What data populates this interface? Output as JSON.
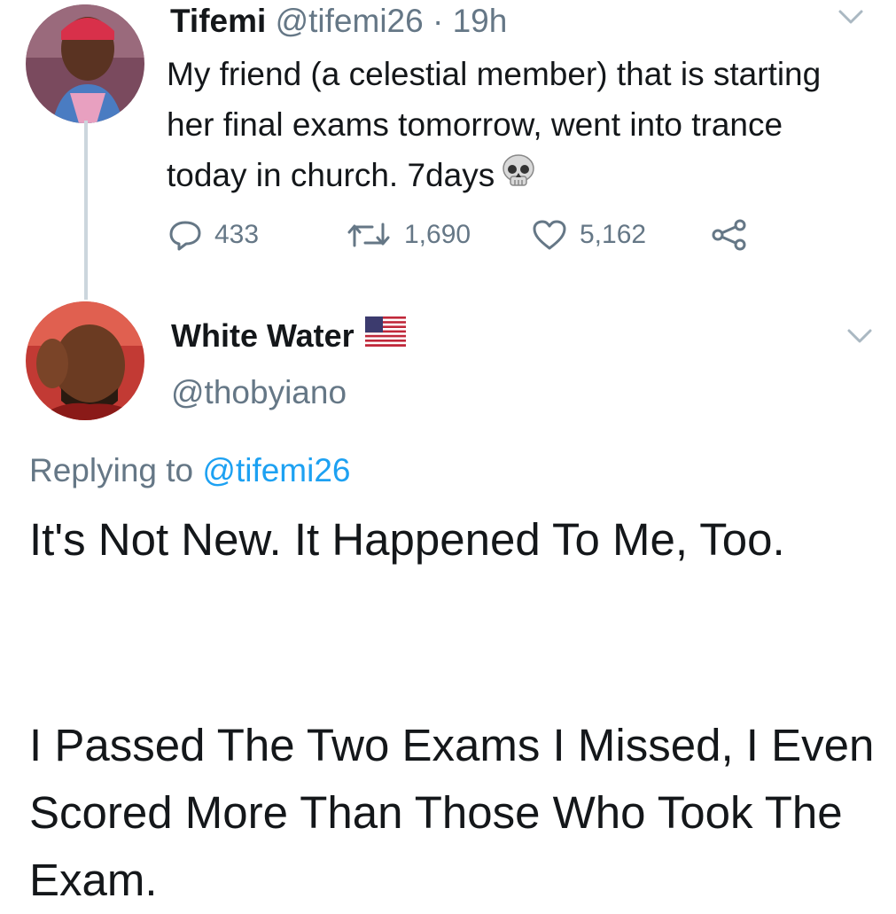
{
  "tweet1": {
    "name": "Tifemi",
    "handle": "@tifemi26",
    "separator": "·",
    "time": "19h",
    "text": "My friend (a celestial member) that is starting her final exams tomorrow, went into trance today in church. 7days",
    "emoji_icon": "skull-icon",
    "actions": {
      "replies": "433",
      "retweets": "1,690",
      "likes": "5,162"
    }
  },
  "tweet2": {
    "name": "White Water",
    "flag_icon": "us-flag-icon",
    "handle": "@thobyiano",
    "replying_prefix": "Replying to",
    "replying_mention": "@tifemi26",
    "paragraph1": "It's Not New. It Happened To Me, Too.",
    "paragraph2": "I Passed The Two Exams I Missed, I Even Scored More Than Those Who Took The Exam."
  },
  "colors": {
    "text": "#14171a",
    "secondary": "#657786",
    "link": "#1da1f2",
    "thread_line": "#ccd6dd"
  }
}
